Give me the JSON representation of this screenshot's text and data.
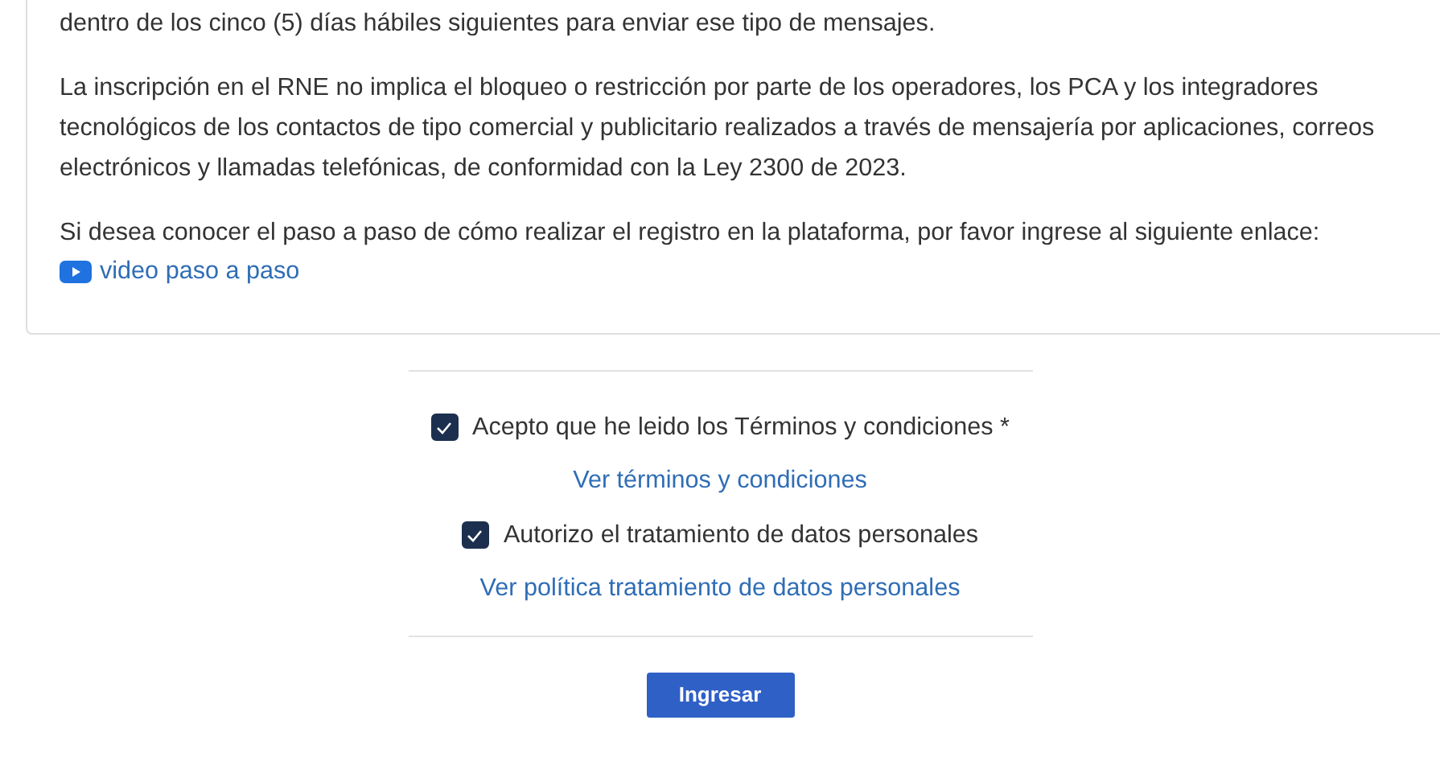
{
  "info_card": {
    "paragraphs": [
      "dentro de los cinco (5) días hábiles siguientes para enviar ese tipo de mensajes.",
      "La inscripción en el RNE no implica el bloqueo o restricción por parte de los operadores, los PCA y los integradores tecnológicos de los contactos de tipo comercial y publicitario realizados a través de mensajería por aplicaciones, correos electrónicos y llamadas telefónicas, de conformidad con la Ley 2300 de 2023.",
      "Si desea conocer el paso a paso de cómo realizar el registro en la plataforma, por favor ingrese al siguiente enlace:"
    ],
    "video_link": "video paso a paso"
  },
  "consents": [
    {
      "label": "Acepto que he leido los Términos y condiciones *",
      "checked": true,
      "link": "Ver términos y condiciones"
    },
    {
      "label": "Autorizo el tratamiento de datos personales",
      "checked": true,
      "link": "Ver política tratamiento de datos personales"
    }
  ],
  "submit_button": "Ingresar"
}
